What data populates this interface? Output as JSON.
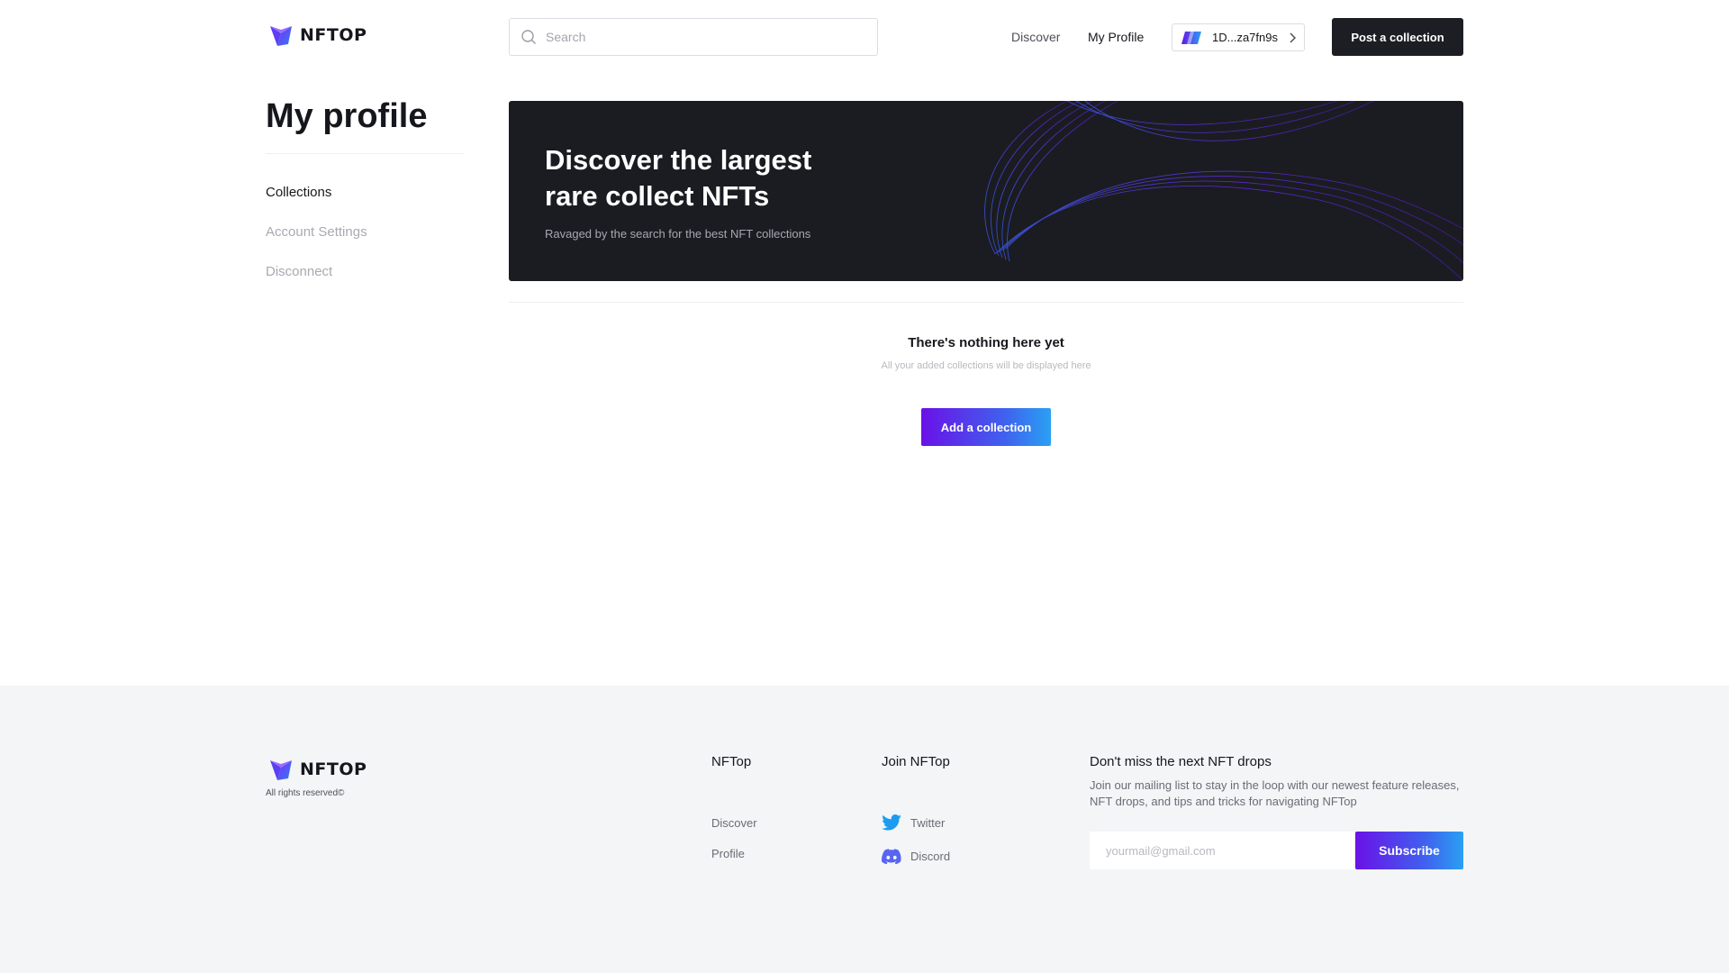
{
  "header": {
    "logo_text": "NFTOP",
    "search": {
      "placeholder": "Search",
      "value": ""
    },
    "nav": {
      "discover": "Discover",
      "my_profile": "My Profile"
    },
    "wallet_address": "1D...za7fn9s",
    "post_button": "Post a collection"
  },
  "sidebar": {
    "title": "My profile",
    "items": [
      {
        "label": "Collections",
        "active": true
      },
      {
        "label": "Account Settings",
        "active": false
      },
      {
        "label": "Disconnect",
        "active": false
      }
    ]
  },
  "banner": {
    "title": "Discover the largest rare collect NFTs",
    "subtitle": "Ravaged by the search for the best NFT collections"
  },
  "empty_state": {
    "title": "There's nothing here yet",
    "subtitle": "All your added collections will be displayed here",
    "button": "Add a collection"
  },
  "footer": {
    "logo_text": "NFTOP",
    "rights": "All rights reserved©",
    "col_nftop": {
      "heading": "NFTop",
      "links": [
        "Discover",
        "Profile"
      ]
    },
    "col_join": {
      "heading": "Join NFTop",
      "links": [
        "Twitter",
        "Discord"
      ]
    },
    "newsletter": {
      "heading": "Don't miss the next NFT drops",
      "text": "Join our mailing list to stay in the loop with our newest feature releases, NFT drops, and tips and tricks for navigating NFTop",
      "placeholder": "yourmail@gmail.com",
      "button": "Subscribe"
    }
  },
  "colors": {
    "accent_start": "#6a11e8",
    "accent_end": "#2aa0f3",
    "dark": "#1d1e24",
    "footer_bg": "#f4f5f7"
  },
  "icons": [
    "nftop-logo-icon",
    "search-icon",
    "wallet-icon",
    "chevron-right-icon",
    "twitter-icon",
    "discord-icon"
  ]
}
